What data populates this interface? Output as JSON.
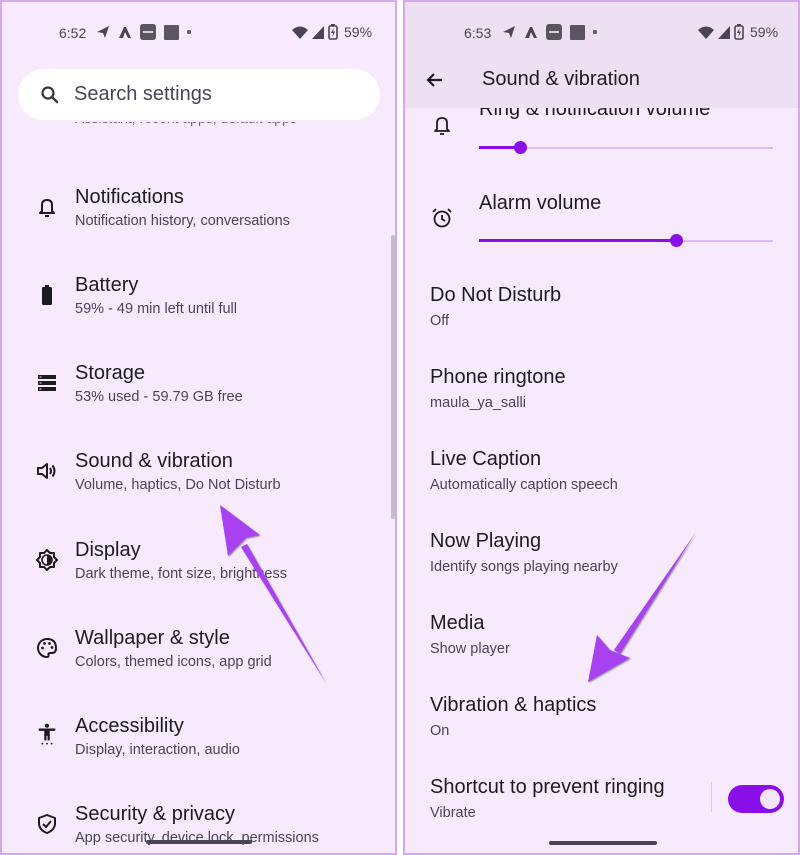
{
  "left_screen": {
    "status_bar": {
      "time": "6:52",
      "battery_percent": "59%",
      "icons": [
        "telegram-icon",
        "app-a-icon",
        "paytm-icon",
        "square-app-icon",
        "dot-icon",
        "wifi-icon",
        "signal-icon",
        "battery-charging-icon"
      ]
    },
    "search": {
      "placeholder": "Search settings",
      "value": ""
    },
    "clipped_item_subtitle": "Assistant, recent apps, default apps",
    "items": [
      {
        "title": "Notifications",
        "subtitle": "Notification history, conversations",
        "icon": "bell-icon"
      },
      {
        "title": "Battery",
        "subtitle": "59% - 49 min left until full",
        "icon": "battery-icon"
      },
      {
        "title": "Storage",
        "subtitle": "53% used - 59.79 GB free",
        "icon": "storage-icon"
      },
      {
        "title": "Sound & vibration",
        "subtitle": "Volume, haptics, Do Not Disturb",
        "icon": "speaker-icon"
      },
      {
        "title": "Display",
        "subtitle": "Dark theme, font size, brightness",
        "icon": "brightness-icon"
      },
      {
        "title": "Wallpaper & style",
        "subtitle": "Colors, themed icons, app grid",
        "icon": "palette-icon"
      },
      {
        "title": "Accessibility",
        "subtitle": "Display, interaction, audio",
        "icon": "accessibility-icon"
      },
      {
        "title": "Security & privacy",
        "subtitle": "App security, device lock, permissions",
        "icon": "shield-check-icon"
      }
    ]
  },
  "right_screen": {
    "status_bar": {
      "time": "6:53",
      "battery_percent": "59%"
    },
    "header": {
      "title": "Sound & vibration",
      "back_icon": "arrow-left-icon"
    },
    "volumes": [
      {
        "title": "Ring & notification volume",
        "icon": "bell-icon",
        "level_percent": 14
      },
      {
        "title": "Alarm volume",
        "icon": "alarm-icon",
        "level_percent": 67
      }
    ],
    "items": [
      {
        "title": "Do Not Disturb",
        "subtitle": "Off"
      },
      {
        "title": "Phone ringtone",
        "subtitle": "maula_ya_salli"
      },
      {
        "title": "Live Caption",
        "subtitle": "Automatically caption speech"
      },
      {
        "title": "Now Playing",
        "subtitle": "Identify songs playing nearby"
      },
      {
        "title": "Media",
        "subtitle": "Show player"
      },
      {
        "title": "Vibration & haptics",
        "subtitle": "On"
      },
      {
        "title": "Shortcut to prevent ringing",
        "subtitle": "Vibrate",
        "toggle_on": true
      }
    ]
  },
  "colors": {
    "accent": "#8a0ee8",
    "annotation_arrow": "#a843f0",
    "background": "#f7eafc",
    "panel_border": "#d4a8f0"
  }
}
